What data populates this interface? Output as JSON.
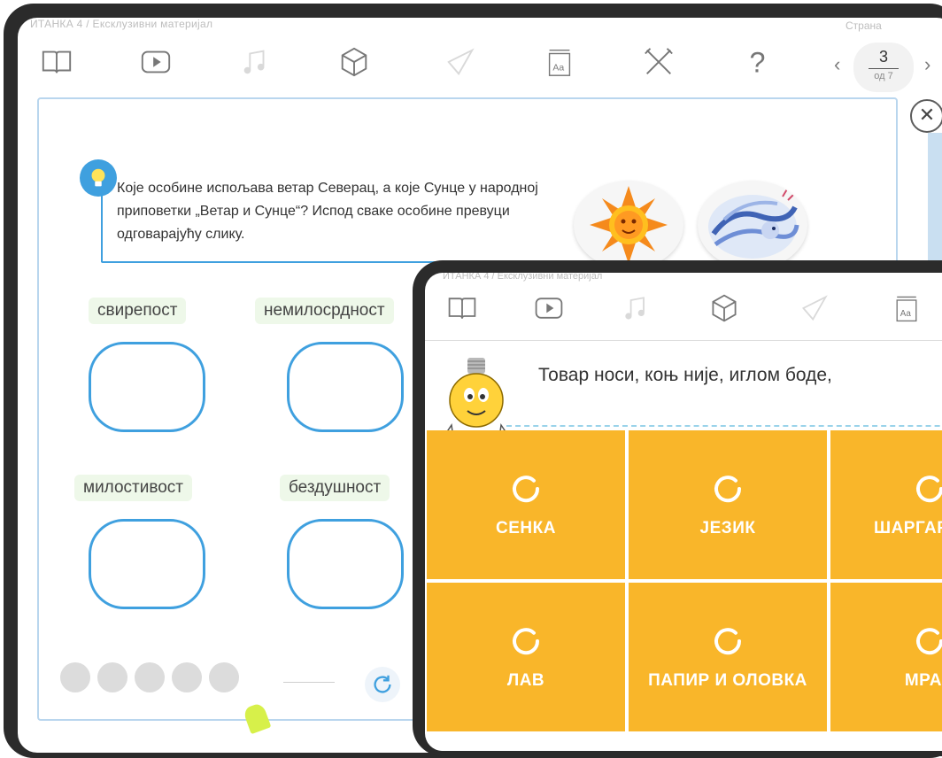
{
  "back": {
    "crumb": "ИТАНКА 4 / Ексклузивни материјал",
    "page": {
      "label": "Страна",
      "current": "3",
      "of": "од 7"
    },
    "toolbar_icons": [
      "book-icon",
      "play-icon",
      "music-icon",
      "cube-icon",
      "geometry-icon",
      "text-icon",
      "tools-icon",
      "help-icon"
    ],
    "close": "✕",
    "instruction": "Које особине испољава ветар Северац, а које Сунце у народној приповетки „Ветар и Сунце“? Испод сваке особине превуци одговарајућу слику.",
    "words": [
      "свирепост",
      "немилосрдност",
      "милостивост",
      "бездушност"
    ],
    "dots": 5
  },
  "front": {
    "crumb": "ИТАНКА 4 / Ексклузивни материјал",
    "riddle": "Товар носи, коњ није, иглом боде,",
    "tiles": [
      "СЕНКА",
      "ЈЕЗИК",
      "ШАРГАРЕПА",
      "ЛАВ",
      "ПАПИР И ОЛОВКА",
      "МРАВ"
    ]
  },
  "colors": {
    "accent": "#3fa0df",
    "tile": "#f9b62a",
    "frame": "#2b2b2b"
  }
}
